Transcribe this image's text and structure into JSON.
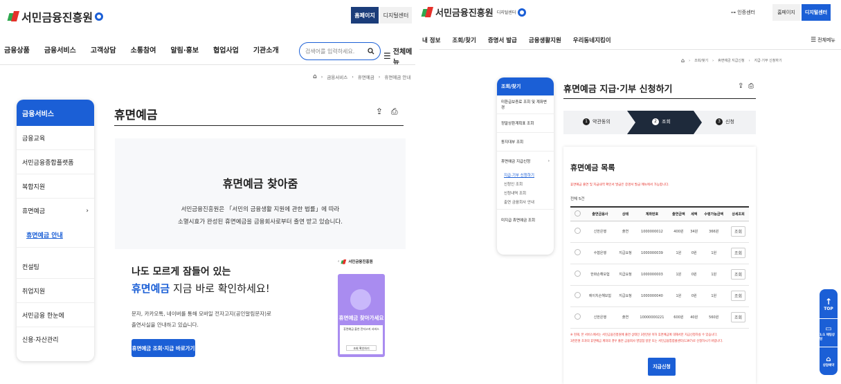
{
  "left": {
    "logo_text": "서민금융진흥원",
    "header_buttons": {
      "home": "홈페이지",
      "digital": "디지털센터"
    },
    "nav": [
      "금융상품",
      "금융서비스",
      "고객상담",
      "소통참여",
      "알림·홍보",
      "협업사업",
      "기관소개"
    ],
    "search_placeholder": "검색어를 입력하세요.",
    "menu_label": "전체메뉴",
    "breadcrumb": [
      "금융서비스",
      "휴면예금",
      "휴면예금 안내"
    ],
    "sidebar": {
      "title": "금융서비스",
      "items": [
        "금융교육",
        "서민금융종합플랫폼",
        "복합지원",
        "휴면예금",
        "휴면예금 안내",
        "컨설팅",
        "취업지원",
        "서민금융 한눈에",
        "신용·자산관리"
      ]
    },
    "page_title": "휴면예금",
    "hero": {
      "title": "휴면예금 찾아줌",
      "desc1": "서민금융진흥원은 「서민의 금융생활 지원에 관한 법률」에 따라",
      "desc2": "소멸시효가 완성된 휴면예금을 금융회사로부터 출연 받고 있습니다."
    },
    "promo": {
      "line1": "나도 모르게 잠들어 있는",
      "highlight": "휴면예금",
      "line2_rest": " 지금 바로 확인하세요!",
      "desc1": "문자, 카카오톡, 네이버를 통해 모바일 전자고지(공인알림문자)로",
      "desc2": "출연사실을 안내하고 있습니다.",
      "button": "휴면예금 조회·지급 바로가기"
    },
    "phone": {
      "logo": "서민금융진흥원",
      "banner": "휴면예금 찾아가세요",
      "sub": "휴면예금 출연 전자고지 서비스",
      "btn": "조회 확인하기"
    }
  },
  "right": {
    "logo_text": "서민금융진흥원",
    "logo_sub": "디지털센터",
    "header_links": {
      "cert": "인증센터",
      "home": "홈페이지",
      "digital": "디지털센터"
    },
    "nav": [
      "내 정보",
      "조회/찾기",
      "증명서 발급",
      "금융생활지원",
      "우리동네지킴이"
    ],
    "menu_label": "전체메뉴",
    "breadcrumb": [
      "조회/찾기",
      "휴면예금 지급신청",
      "지급·기부 신청하기"
    ],
    "sidebar": {
      "title": "조회/찾기",
      "items": [
        "미환급보증료 조회 및 계좌변경",
        "정말상환계획표 조회",
        "동지대부 조회",
        "휴면예금 지급신청",
        "미지급 휴면예금 조회"
      ],
      "sub": [
        "지급·기부 신청하기",
        "신청인 조회",
        "신청내역 조회",
        "출연 금융회사 안내"
      ]
    },
    "page_title": "휴면예금 지급·기부 신청하기",
    "steps": [
      "약관동의",
      "조회",
      "신청"
    ],
    "list_title": "휴면예금 목록",
    "note": "휴면예금 출연 및 지급내역 확인서 발급은 증명서 발급 메뉴에서 가능합니다.",
    "total": "전체 5건",
    "table": {
      "headers": [
        "",
        "출연금융사",
        "상태",
        "계좌번호",
        "출연금액",
        "세액",
        "수령가능금액",
        "상세조회"
      ],
      "rows": [
        [
          "",
          "신한은행",
          "출연",
          "1000000012",
          "400원",
          "34원",
          "366원",
          "조회"
        ],
        [
          "",
          "수협은행",
          "지급요청",
          "1000000039",
          "1원",
          "0원",
          "1원",
          "조회"
        ],
        [
          "",
          "한화손해보험",
          "지급요청",
          "1000000003",
          "1원",
          "0원",
          "1원",
          "조회"
        ],
        [
          "",
          "에이치손해보험",
          "지급요청",
          "1000000040",
          "1원",
          "0원",
          "1원",
          "조회"
        ],
        [
          "",
          "신한은행",
          "출연",
          "10000000221",
          "600원",
          "40원",
          "560원",
          "조회"
        ]
      ]
    },
    "warn1": "※ 현재, 본 서비스에서는 서민금융진흥원에 출연 상태인 3천만원 이하 휴면예금에 대해서만 지급신청하실 수 있습니다.",
    "warn2": "3천만원 초과의 휴면예금 계좌의 경우 출연 금융회사 영업점 방문 또는 서민금융통합콜센터(1397)로 신청하시기 바랍니다.",
    "apply_button": "지급신청",
    "float": {
      "top": "TOP",
      "chat": "1:1 채팅상담",
      "visit": "상담예약"
    }
  },
  "colors": {
    "primary": "#1b5fd6",
    "navy": "#1b3d7a",
    "warn": "#e5312a",
    "purple": "#7b5fe0"
  }
}
